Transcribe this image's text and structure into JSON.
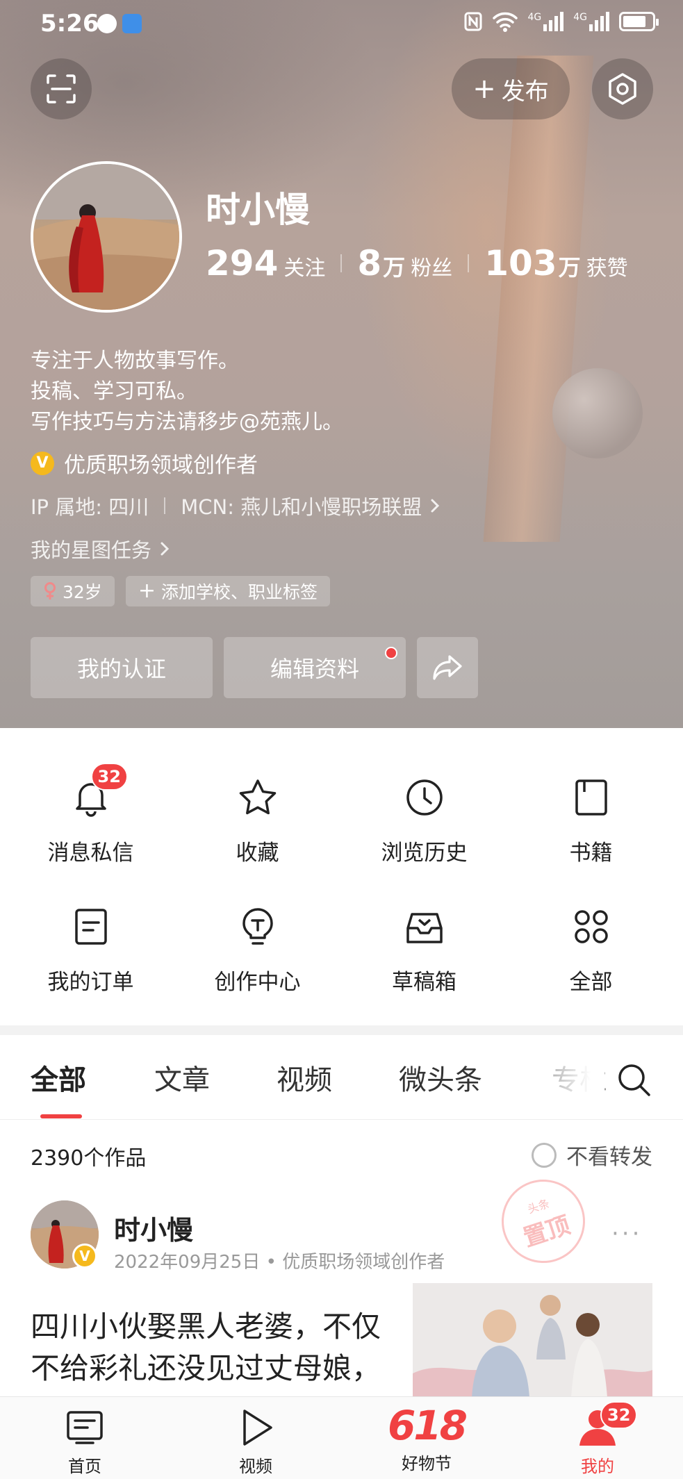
{
  "status_bar": {
    "time": "5:26",
    "network_1": "4G",
    "network_2": "4G"
  },
  "header": {
    "publish_label": "发布"
  },
  "profile": {
    "name": "时小慢",
    "stats": [
      {
        "value": "294",
        "unit": "",
        "label": "关注"
      },
      {
        "value": "8",
        "unit": "万",
        "label": "粉丝"
      },
      {
        "value": "103",
        "unit": "万",
        "label": "获赞"
      }
    ],
    "bio": [
      "专注于人物故事写作。",
      "投稿、学习可私。",
      "写作技巧与方法请移步@苑燕儿。"
    ],
    "verified_badge": "V",
    "certification": "优质职场领域创作者",
    "ip_location": "IP 属地: 四川",
    "mcn": "MCN: 燕儿和小慢职场联盟",
    "star_tasks": "我的星图任务",
    "tags": {
      "age": "32岁",
      "add": "添加学校、职业标签"
    },
    "actions": {
      "verify": "我的认证",
      "edit": "编辑资料"
    }
  },
  "grid_menu": [
    {
      "label": "消息私信",
      "icon": "bell-icon",
      "badge": "32"
    },
    {
      "label": "收藏",
      "icon": "star-icon"
    },
    {
      "label": "浏览历史",
      "icon": "clock-icon"
    },
    {
      "label": "书籍",
      "icon": "book-icon"
    },
    {
      "label": "我的订单",
      "icon": "order-icon"
    },
    {
      "label": "创作中心",
      "icon": "bulb-icon"
    },
    {
      "label": "草稿箱",
      "icon": "inbox-icon"
    },
    {
      "label": "全部",
      "icon": "grid-icon"
    }
  ],
  "tabs": [
    "全部",
    "文章",
    "视频",
    "微头条",
    "专栏"
  ],
  "works": {
    "count": "2390个作品",
    "filter": "不看转发"
  },
  "post": {
    "author": "时小慢",
    "avatar_badge": "V",
    "meta": "2022年09月25日 • 优质职场领域创作者",
    "title": "四川小伙娶黑人老婆，不仅不给彩礼还没见过丈母娘，",
    "pin_small": "头条",
    "pin_big": "置顶",
    "more": "···"
  },
  "bottom_nav": [
    {
      "label": "首页",
      "icon": "home-icon"
    },
    {
      "label": "视频",
      "icon": "play-icon"
    },
    {
      "label": "好物节",
      "promo": "618"
    },
    {
      "label": "我的",
      "icon": "user-icon",
      "badge": "32"
    }
  ],
  "colors": {
    "accent": "#f04142",
    "verified": "#f5b91d"
  }
}
